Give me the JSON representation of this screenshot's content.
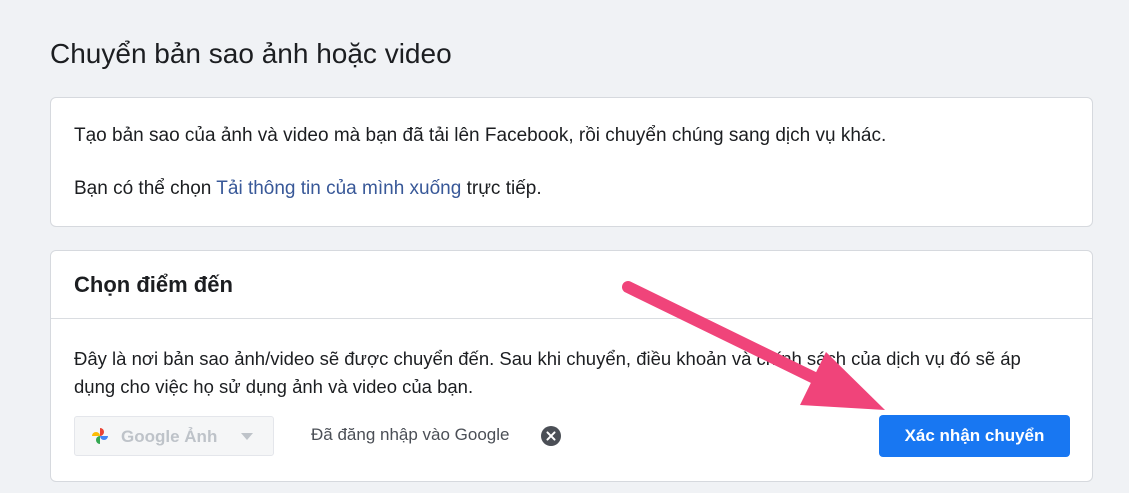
{
  "page": {
    "title": "Chuyển bản sao ảnh hoặc video"
  },
  "intro": {
    "line1": "Tạo bản sao của ảnh và video mà bạn đã tải lên Facebook, rồi chuyển chúng sang dịch vụ khác.",
    "line2_prefix": "Bạn có thể chọn ",
    "line2_link": "Tải thông tin của mình xuống",
    "line2_suffix": " trực tiếp."
  },
  "destination": {
    "header": "Chọn điểm đến",
    "description": "Đây là nơi bản sao ảnh/video sẽ được chuyển đến. Sau khi chuyển, điều khoản và chính sách của dịch vụ đó sẽ áp dụng cho việc họ sử dụng ảnh và video của bạn.",
    "selected_service": "Google Ảnh",
    "service_icon": "google-photos-pinwheel-icon",
    "signed_in_text": "Đã đăng nhập vào Google",
    "confirm_label": "Xác nhận chuyển"
  },
  "colors": {
    "background": "#f0f2f5",
    "primary_button": "#1877f2",
    "link": "#385898",
    "annotation_arrow": "#f0447a"
  }
}
